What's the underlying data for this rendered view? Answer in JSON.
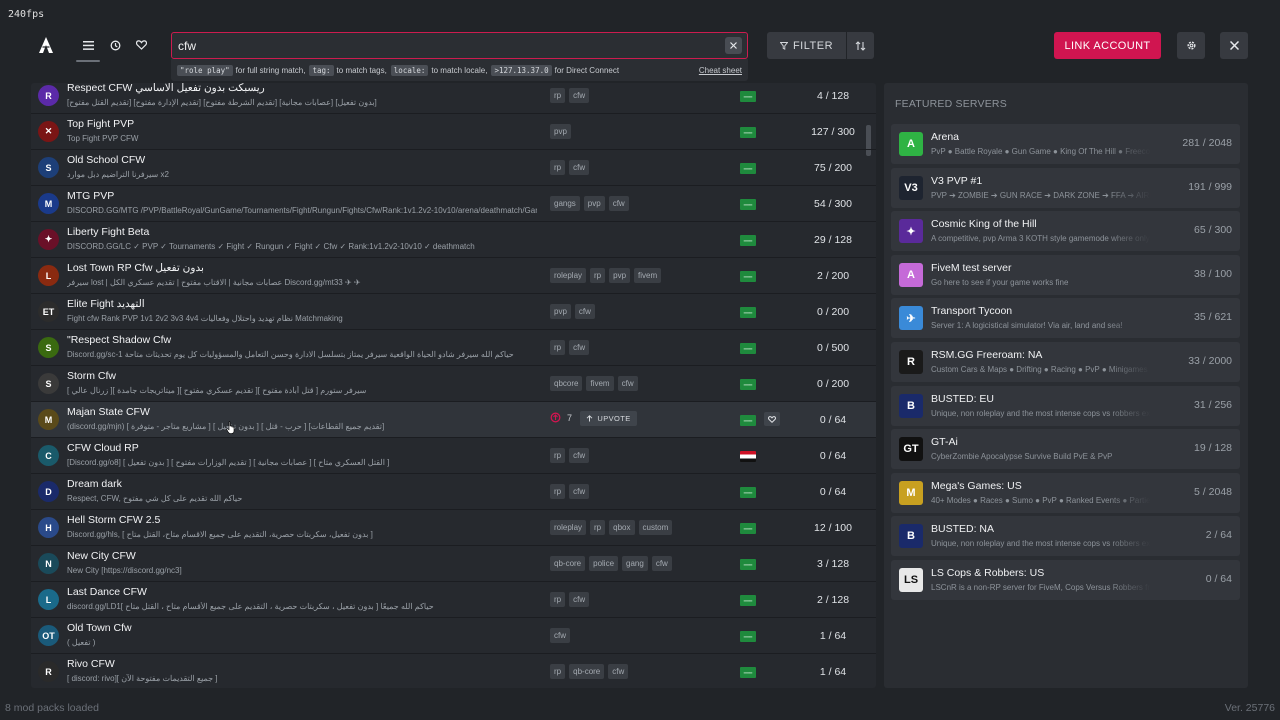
{
  "fps": "240fps",
  "nav": {
    "icons": [
      "list-icon",
      "history-icon",
      "heart-icon"
    ]
  },
  "search": {
    "value": "cfw",
    "hint": {
      "code1": "\"role play\"",
      "txt1": "for full string match,",
      "code2": "tag:",
      "txt2": "to match tags,",
      "code3": "locale:",
      "txt3": "to match locale,",
      "code4": ">127.13.37.0",
      "txt4": "for Direct Connect",
      "cheat": "Cheat sheet"
    }
  },
  "toolbar": {
    "filter_label": "FILTER",
    "link_label": "LINK ACCOUNT"
  },
  "servers": [
    {
      "name": "Respect CFW ريسبكت بدون تفعيل الاساسي",
      "desc": "[تقديم القتل مفتوح] [تقديم الإدارة مفتوح] [تقديم الشرطة مفتوح] [عصابات مجانية] [بدون تفعيل]",
      "tags": [
        "rp",
        "cfw"
      ],
      "players": "4 / 128",
      "icon": "R",
      "icon_color": "#5b2aa8",
      "flag": "sa"
    },
    {
      "name": "Top Fight PVP",
      "desc": "Top Fight PVP CFW",
      "tags": [
        "pvp"
      ],
      "players": "127 / 300",
      "icon": "✕",
      "icon_color": "#7a1515",
      "flag": "sa"
    },
    {
      "name": "Old School CFW",
      "desc": "سيرفرنا التراضيم دبل موارد x2",
      "tags": [
        "rp",
        "cfw"
      ],
      "players": "75 / 200",
      "icon": "S",
      "icon_color": "#1d3f78",
      "flag": "sa"
    },
    {
      "name": "MTG PVP",
      "desc": "DISCORD.GG/MTG /PVP/BattleRoyal/GunGame/Tournaments/Fight/Rungun/Fights/Cfw/Rank:1v1.2v2-10v10/arena/deathmatch/Gangwar/Teams/Hunger Games",
      "tags": [
        "gangs",
        "pvp",
        "cfw"
      ],
      "players": "54 / 300",
      "icon": "M",
      "icon_color": "#1a3a8a",
      "flag": "sa"
    },
    {
      "name": "Liberty Fight Beta",
      "desc": "DISCORD.GG/LC ✓ PVP ✓ Tournaments ✓ Fight ✓ Rungun ✓ Fight ✓ Cfw ✓ Rank:1v1.2v2-10v10 ✓ deathmatch",
      "tags": [],
      "players": "29 / 128",
      "icon": "✦",
      "icon_color": "#6a1028",
      "flag": "sa"
    },
    {
      "name": "Lost Town RP Cfw بدون تفعيل",
      "desc": "سيرفر lost | عصابات مجانية | الاقتاب مفتوح | تقديم عسكري الكل Discord.gg/mt33 ✈ ✈",
      "tags": [
        "roleplay",
        "rp",
        "pvp",
        "fivem"
      ],
      "players": "2 / 200",
      "icon": "L",
      "icon_color": "#8a2a10",
      "flag": "sa"
    },
    {
      "name": "Elite Fight التهديد",
      "desc": "Fight cfw Rank PVP 1v1 2v2 3v3 4v4 نظام تهديد واحتلال وفعاليات Matchmaking",
      "tags": [
        "pvp",
        "cfw"
      ],
      "players": "0 / 200",
      "icon": "ET",
      "icon_color": "#2c2c2c",
      "flag": "sa"
    },
    {
      "name": "\"Respect Shadow Cfw",
      "desc": "Discord.gg/sc-1 حياكم الله سيرفر شادو الحياة الواقعية سيرفر يمتاز بتسلسل الادارة وحسن التعامل والمسؤوليات كل يوم تحديثات متاحة",
      "tags": [
        "rp",
        "cfw"
      ],
      "players": "0 / 500",
      "icon": "S",
      "icon_color": "#3a6a10",
      "flag": "sa"
    },
    {
      "name": "Storm Cfw",
      "desc": "سيرفر ستورم [ قتل أبادة مفتوح ][ تقديم عسكري مفتوح ][ ميتاتريجات جامدة ][ زرنال عالي ]",
      "tags": [
        "qbcore",
        "fivem",
        "cfw"
      ],
      "players": "0 / 200",
      "icon": "S",
      "icon_color": "#3a3a3a",
      "flag": "sa"
    },
    {
      "name": "Majan State CFW",
      "desc": "(discord.gg/mjn) [ مشاريع متاجر - متوفرة ] [ بدون تفعيل ] [ حرب - قتل ] [تقديم جميع القطاعات]",
      "tags": [],
      "players": "0 / 64",
      "icon": "M",
      "icon_color": "#5a4a1a",
      "flag": "sa",
      "upvotes": "7",
      "upvote_label": "UPVOTE",
      "hover": true
    },
    {
      "name": "CFW Cloud RP",
      "desc": "[Discord.gg/o8] [ بدون تفعيل ] [ تقديم الوزارات مفتوح ] [ عصابات مجانية ] [ القتل العسكري متاح ]",
      "tags": [
        "rp",
        "cfw"
      ],
      "players": "0 / 64",
      "icon": "C",
      "icon_color": "#1a5a6a",
      "flag": "iq"
    },
    {
      "name": "Dream dark",
      "desc": "Respect, CFW, حياكم الله تقديم على كل شي مفتوح",
      "tags": [
        "rp",
        "cfw"
      ],
      "players": "0 / 64",
      "icon": "D",
      "icon_color": "#1a2a6a",
      "flag": "sa"
    },
    {
      "name": "Hell Storm CFW 2.5",
      "desc": "Discord.gg/hls, [ بدون تفعيل، سكربتات حصرية، التقديم على جميع الاقسام متاح، القتل متاح ]",
      "tags": [
        "roleplay",
        "rp",
        "qbox",
        "custom"
      ],
      "players": "12 / 100",
      "icon": "H",
      "icon_color": "#2a4a8a",
      "flag": "sa"
    },
    {
      "name": "New City CFW",
      "desc": "New City [https://discord.gg/nc3]",
      "tags": [
        "qb-core",
        "police",
        "gang",
        "cfw"
      ],
      "players": "3 / 128",
      "icon": "N",
      "icon_color": "#1a4a5a",
      "flag": "sa"
    },
    {
      "name": "Last Dance CFW",
      "desc": "discord.gg/LD1[ بدون تفعيل ، سكربتات حصرية ، التقديم على جميع الأقسام متاح ، القتل متاح ] حياكم الله جميعًا",
      "tags": [
        "rp",
        "cfw"
      ],
      "players": "2 / 128",
      "icon": "L",
      "icon_color": "#1a6a8a",
      "flag": "sa"
    },
    {
      "name": "Old Town Cfw",
      "desc": "( تفعيل )",
      "tags": [
        "cfw"
      ],
      "players": "1 / 64",
      "icon": "OT",
      "icon_color": "#1a5a7a",
      "flag": "sa"
    },
    {
      "name": "Rivo CFW",
      "desc": "[ discord: rivo][ جميع التقديمات مفتوحة الآن ]",
      "tags": [
        "rp",
        "qb-core",
        "cfw"
      ],
      "players": "1 / 64",
      "icon": "R",
      "icon_color": "#2a2a2a",
      "flag": "sa"
    }
  ],
  "featured": {
    "title": "FEATURED SERVERS",
    "items": [
      {
        "name": "Arena",
        "desc": "PvP ● Battle Royale ● Gun Game ● King Of The Hill ● Freecoast",
        "players": "281 / 2048",
        "icon": "A",
        "color": "#2fb344"
      },
      {
        "name": "V3 PVP #1",
        "desc": "PVP ➔ ZOMBIE ➔ GUN RACE ➔ DARK ZONE ➔ FFA ➔ AIRDROP",
        "players": "191 / 999",
        "icon": "V3",
        "color": "#1e2430"
      },
      {
        "name": "Cosmic King of the Hill",
        "desc": "A competitive, pvp Arma 3 KOTH style gamemode where only the",
        "players": "65 / 300",
        "icon": "✦",
        "color": "#5a2a9a"
      },
      {
        "name": "FiveM test server",
        "desc": "Go here to see if your game works fine",
        "players": "38 / 100",
        "icon": "A",
        "color": "#c56ad8"
      },
      {
        "name": "Transport Tycoon",
        "desc": "Server 1: A logicistical simulator! Via air, land and sea!",
        "players": "35 / 621",
        "icon": "✈",
        "color": "#3a8ad8"
      },
      {
        "name": "RSM.GG Freeroam: NA",
        "desc": "Custom Cars & Maps ● Drifting ● Racing ● PvP ● Minigames ●",
        "players": "33 / 2000",
        "icon": "R",
        "color": "#1a1a1a"
      },
      {
        "name": "BUSTED: EU",
        "desc": "Unique, non roleplay and the most intense cops vs robbers experience",
        "players": "31 / 256",
        "icon": "B",
        "color": "#1a2a6a"
      },
      {
        "name": "GT-Ai",
        "desc": "CyberZombie Apocalypse Survive Build PvE & PvP",
        "players": "19 / 128",
        "icon": "GT",
        "color": "#111111"
      },
      {
        "name": "Mega's Games: US",
        "desc": "40+ Modes ● Races ● Sumo ● PvP ● Ranked Events ● Parties ●",
        "players": "5 / 2048",
        "icon": "M",
        "color": "#c8a020"
      },
      {
        "name": "BUSTED: NA",
        "desc": "Unique, non roleplay and the most intense cops vs robbers experience",
        "players": "2 / 64",
        "icon": "B",
        "color": "#1a2a6a"
      },
      {
        "name": "LS Cops & Robbers: US",
        "desc": "LSCnR is a non-RP server for FiveM, Cops Versus Robbers freeroam",
        "players": "0 / 64",
        "icon": "LS",
        "color": "#e8e8e8"
      }
    ]
  },
  "footer": {
    "left": "8 mod packs loaded",
    "right": "Ver. 25776"
  },
  "colors": {
    "accent": "#d01550",
    "bg": "#212428",
    "panel": "#26292e"
  }
}
